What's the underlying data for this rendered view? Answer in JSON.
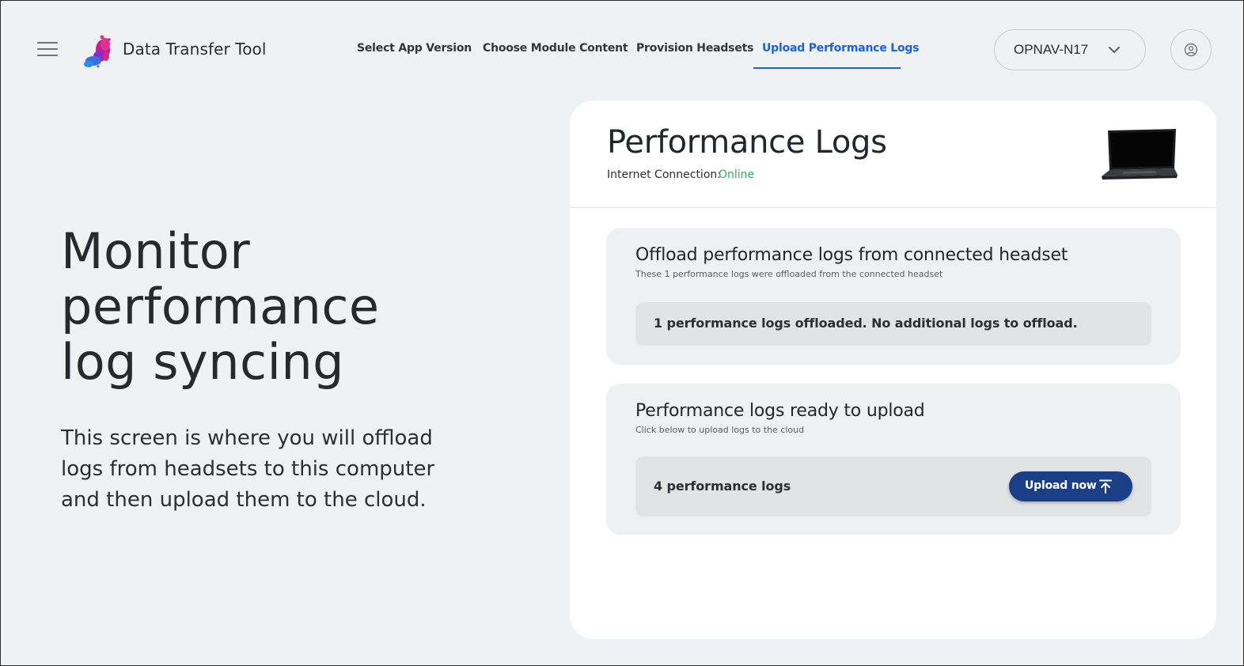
{
  "app": {
    "title": "Data Transfer Tool"
  },
  "nav": {
    "items": [
      {
        "label": "Select App Version"
      },
      {
        "label": "Choose Module Content"
      },
      {
        "label": "Provision Headsets"
      },
      {
        "label": "Upload Performance Logs",
        "active": true
      }
    ]
  },
  "device_select": {
    "value": "OPNAV-N17"
  },
  "icons": {
    "menu": "hamburger-menu-icon",
    "device_dropdown": "chevron-down-icon",
    "account": "user-circle-icon",
    "laptop": "laptop-icon",
    "upload": "upload-arrow-icon"
  },
  "hero": {
    "title_lines": [
      "Monitor",
      "performance",
      "log syncing"
    ],
    "description": "This screen is where you will offload logs from headsets to this computer and then upload them to the cloud."
  },
  "card": {
    "title": "Performance Logs",
    "connection_label": "Internet Connection:",
    "connection_status": "Online",
    "offload": {
      "title": "Offload performance logs from connected headset",
      "subtitle": "These 1 performance logs were offloaded from the connected headset",
      "status": "1 performance logs offloaded. No additional logs to offload."
    },
    "upload": {
      "title": "Performance logs ready to upload",
      "subtitle": "Click below to upload logs to the cloud",
      "count_text": "4 performance logs",
      "button_label": "Upload now"
    }
  },
  "colors": {
    "background": "#f0f1f3",
    "accent": "#1a63d8",
    "online": "#2bb15b",
    "primary_button": "#1a3f86"
  }
}
